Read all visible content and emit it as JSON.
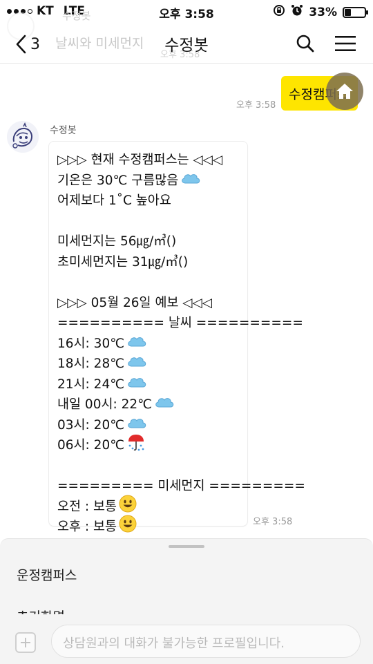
{
  "status_bar": {
    "carrier": "KT",
    "network": "LTE",
    "time": "오후 3:58",
    "battery": "33%",
    "battery_level": 0.33
  },
  "header": {
    "title": "수정봇",
    "back_count": "3",
    "ghost_sender": "수정봇",
    "ghost_message": "날씨와 미세먼지",
    "ghost_time": "오후 3:58"
  },
  "chat": {
    "my_message": {
      "text": "수정캠퍼스",
      "time": "오후 3:58"
    },
    "bot_message": {
      "sender": "수정봇",
      "time": "오후 3:58",
      "lines": [
        "▷▷▷ 현재 수정캠퍼스는 ◁◁◁",
        "기온은 30℃ 구름많음",
        "어제보다 1˚C 높아요",
        "",
        "미세먼지는 56㎍/㎥()",
        "초미세먼지는 31㎍/㎥()",
        "",
        "▷▷▷ 05월 26일 예보 ◁◁◁",
        "========== 날씨 ==========",
        "16시: 30℃",
        "18시: 28℃",
        "21시: 24℃",
        "내일 00시: 22℃",
        "03시: 20℃",
        "06시: 20℃",
        "",
        "========= 미세먼지 =========",
        "오전 : 보통",
        "오후 : 보통"
      ],
      "line_emojis": [
        "",
        "cloud-icon",
        "",
        "",
        "",
        "",
        "",
        "",
        "",
        "cloud-icon",
        "cloud-icon",
        "cloud-icon",
        "cloud-icon",
        "cloud-icon",
        "umbrella-rain-icon",
        "",
        "",
        "smiley-icon",
        "smiley-icon"
      ]
    }
  },
  "bottom_sheet": {
    "items": [
      "운정캠퍼스",
      "초기화면"
    ]
  },
  "input": {
    "placeholder": "상담원과의 대화가 불가능한 프로필입니다."
  },
  "colors": {
    "my_bubble": "#fee500",
    "home_fab": "#7d6e50",
    "sheet_bg": "#f4f4f4"
  }
}
